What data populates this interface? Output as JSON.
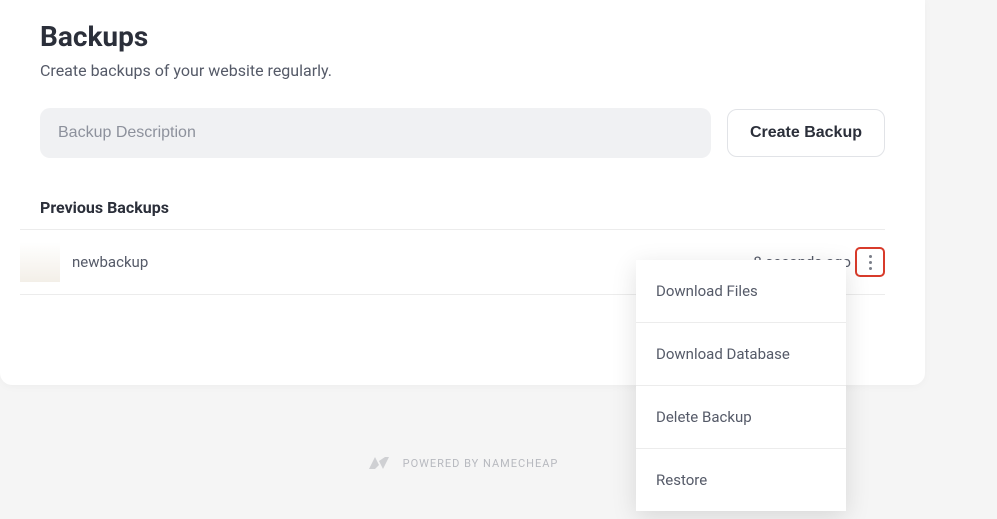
{
  "header": {
    "title": "Backups",
    "subtitle": "Create backups of your website regularly."
  },
  "form": {
    "placeholder": "Backup Description",
    "create_label": "Create Backup"
  },
  "list": {
    "heading": "Previous Backups",
    "items": [
      {
        "name": "newbackup",
        "time": "8 seconds ago"
      }
    ]
  },
  "menu": {
    "download_files": "Download Files",
    "download_database": "Download Database",
    "delete_backup": "Delete Backup",
    "restore": "Restore"
  },
  "footer": {
    "text": "POWERED BY NAMECHEAP"
  }
}
